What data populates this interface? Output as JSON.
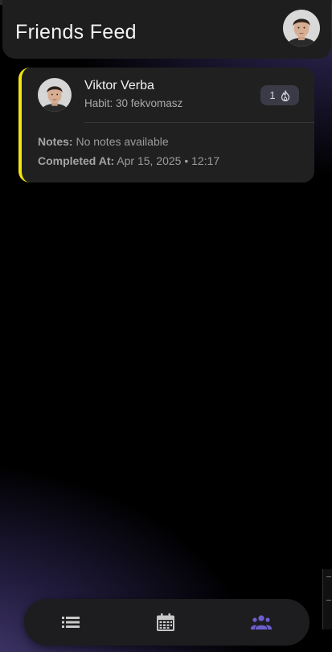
{
  "header": {
    "title": "Friends Feed",
    "avatar_icon": "user-avatar"
  },
  "feed": {
    "items": [
      {
        "name": "Viktor Verba",
        "habit": "Habit: 30 fekvomasz",
        "streak_count": "1",
        "streak_icon": "flame-icon",
        "notes_label": "Notes:",
        "notes_value": "No notes available",
        "completed_label": "Completed At:",
        "completed_value": "Apr 15, 2025 • 12:17",
        "accent_color": "#f5e60a"
      }
    ]
  },
  "bottom_nav": {
    "items": [
      {
        "icon": "list-icon",
        "active": false
      },
      {
        "icon": "calendar-icon",
        "active": false
      },
      {
        "icon": "friends-icon",
        "active": true
      }
    ],
    "active_color": "#6b5fcf",
    "inactive_color": "#c8c8c8"
  }
}
